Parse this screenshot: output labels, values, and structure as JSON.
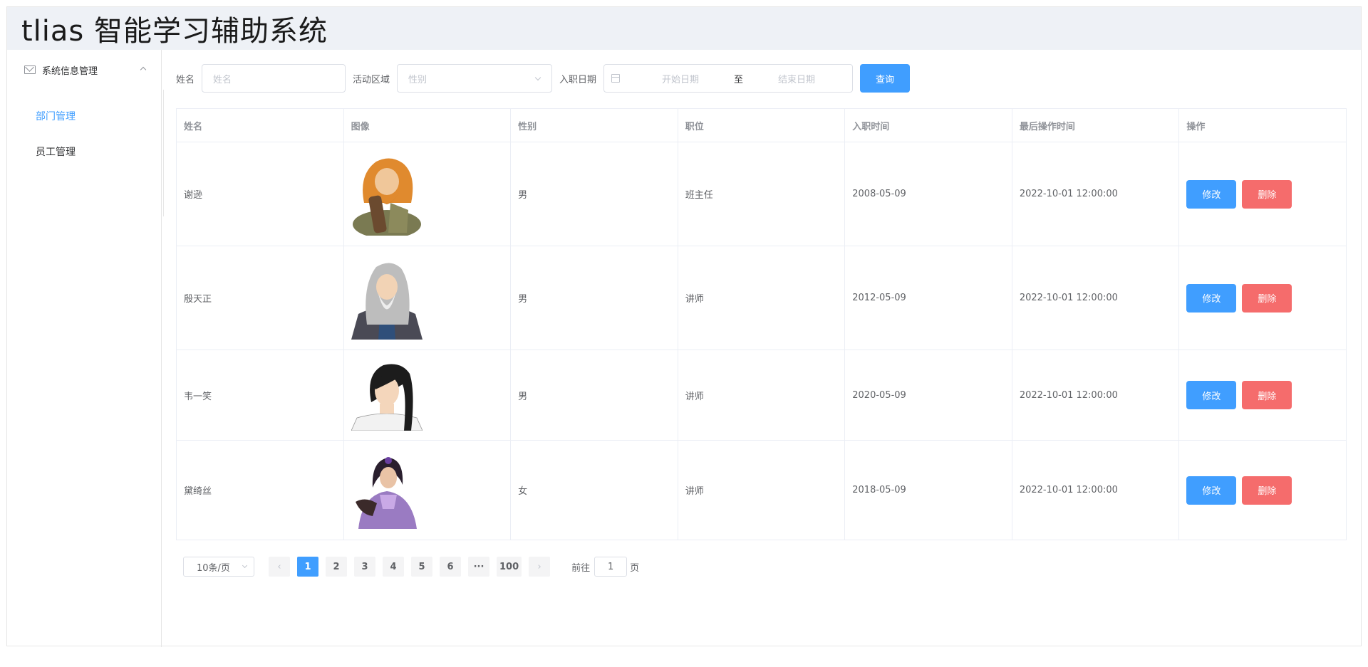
{
  "header": {
    "title": "tlias 智能学习辅助系统"
  },
  "sidebar": {
    "group_label": "系统信息管理",
    "items": [
      {
        "label": "部门管理",
        "active": true
      },
      {
        "label": "员工管理",
        "active": false
      }
    ]
  },
  "search": {
    "name_label": "姓名",
    "name_placeholder": "姓名",
    "area_label": "活动区域",
    "area_placeholder": "性别",
    "date_label": "入职日期",
    "start_placeholder": "开始日期",
    "range_sep": "至",
    "end_placeholder": "结束日期",
    "query_button": "查询"
  },
  "table": {
    "columns": [
      "姓名",
      "图像",
      "性别",
      "职位",
      "入职时间",
      "最后操作时间",
      "操作"
    ],
    "rows": [
      {
        "name": "谢逊",
        "gender": "男",
        "position": "班主任",
        "entry_date": "2008-05-09",
        "updated": "2022-10-01 12:00:00"
      },
      {
        "name": "殷天正",
        "gender": "男",
        "position": "讲师",
        "entry_date": "2012-05-09",
        "updated": "2022-10-01 12:00:00"
      },
      {
        "name": "韦一笑",
        "gender": "男",
        "position": "讲师",
        "entry_date": "2020-05-09",
        "updated": "2022-10-01 12:00:00"
      },
      {
        "name": "黛绮丝",
        "gender": "女",
        "position": "讲师",
        "entry_date": "2018-05-09",
        "updated": "2022-10-01 12:00:00"
      }
    ],
    "edit_label": "修改",
    "delete_label": "删除"
  },
  "pagination": {
    "page_size": "10条/页",
    "prev": "‹",
    "pages": [
      "1",
      "2",
      "3",
      "4",
      "5",
      "6"
    ],
    "ellipsis": "···",
    "last": "100",
    "next": "›",
    "current": "1",
    "goto_prefix": "前往",
    "goto_value": "1",
    "goto_suffix": "页"
  },
  "colors": {
    "primary": "#409eff",
    "danger": "#f56c6c",
    "header_bg": "#eef1f6"
  }
}
